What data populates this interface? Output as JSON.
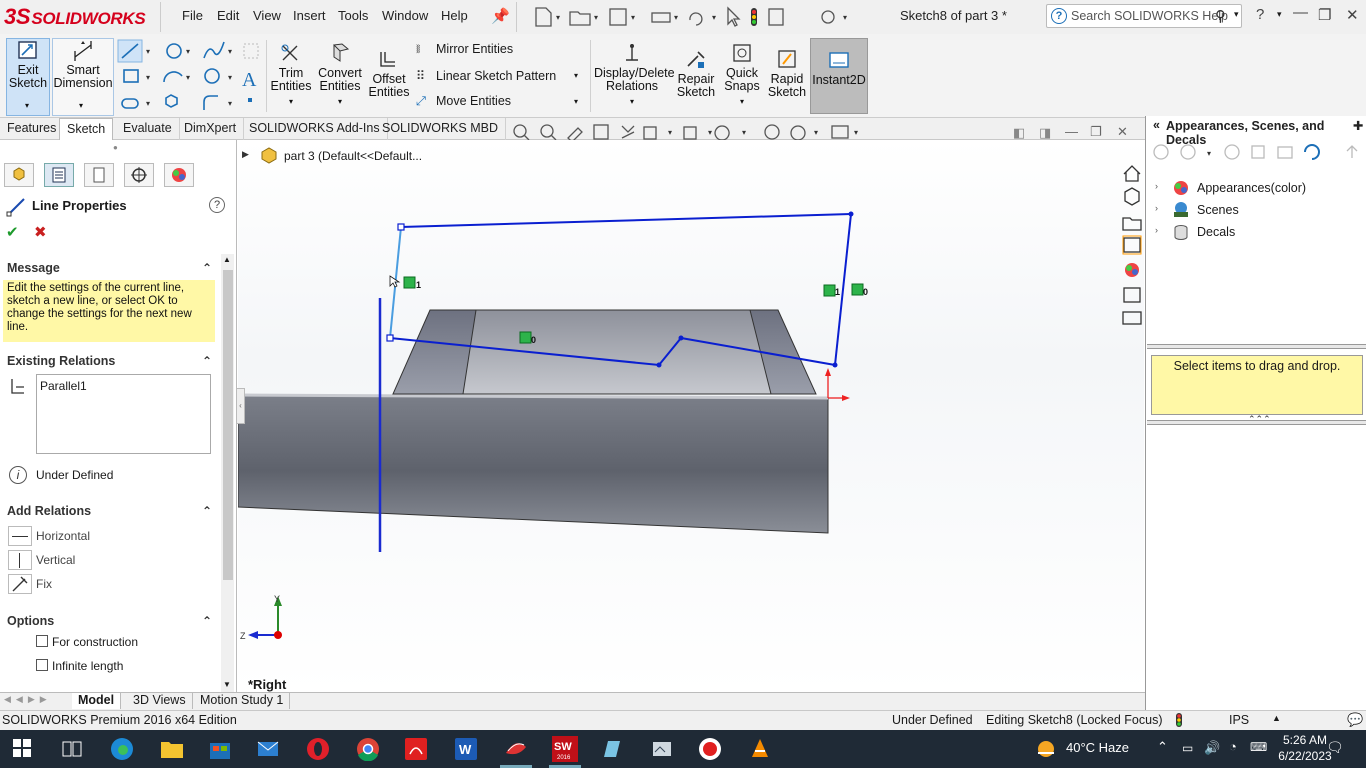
{
  "app": {
    "logo_ds": "3S",
    "logo_text": "SOLIDWORKS",
    "title": "Sketch8 of part 3 *",
    "search_placeholder": "Search SOLIDWORKS Help"
  },
  "menu": [
    "File",
    "Edit",
    "View",
    "Insert",
    "Tools",
    "Window",
    "Help"
  ],
  "ribbon": {
    "exit_sketch": "Exit\nSketch",
    "smart_dimension": "Smart\nDimension",
    "trim_entities": "Trim\nEntities",
    "convert_entities": "Convert\nEntities",
    "offset_entities": "Offset\nEntities",
    "mirror_entities": "Mirror Entities",
    "linear_sketch_pattern": "Linear Sketch Pattern",
    "move_entities": "Move Entities",
    "display_delete_relations": "Display/Delete\nRelations",
    "repair_sketch": "Repair\nSketch",
    "quick_snaps": "Quick\nSnaps",
    "rapid_sketch": "Rapid\nSketch",
    "instant2d": "Instant2D"
  },
  "tabs": [
    "Features",
    "Sketch",
    "Evaluate",
    "DimXpert",
    "SOLIDWORKS Add-Ins",
    "SOLIDWORKS MBD"
  ],
  "active_tab": "Sketch",
  "tree_path": "part 3  (Default<<Default...",
  "property_manager": {
    "title": "Line Properties",
    "message_header": "Message",
    "message_text": "Edit the settings of the current line, sketch a new line, or select OK to change the settings for the next new line.",
    "existing_relations_header": "Existing Relations",
    "relations": [
      "Parallel1"
    ],
    "status": "Under Defined",
    "add_relations_header": "Add Relations",
    "add_relations": [
      "Horizontal",
      "Vertical",
      "Fix"
    ],
    "options_header": "Options",
    "options": [
      {
        "label": "For construction",
        "checked": false
      },
      {
        "label": "Infinite length",
        "checked": false
      }
    ]
  },
  "viewport": {
    "view_name": "*Right",
    "axis_y": "Y",
    "axis_z": "Z",
    "relation_labels": [
      "1",
      "1",
      "0",
      "0"
    ]
  },
  "bottom_tabs": [
    "Model",
    "3D Views",
    "Motion Study 1"
  ],
  "active_bottom_tab": "Model",
  "statusbar": {
    "edition": "SOLIDWORKS Premium 2016 x64 Edition",
    "state": "Under Defined",
    "editing": "Editing Sketch8 (Locked Focus)",
    "units": "IPS"
  },
  "task_pane": {
    "title": "Appearances, Scenes, and Decals",
    "items": [
      "Appearances(color)",
      "Scenes",
      "Decals"
    ],
    "drop_hint": "Select items to drag and drop."
  },
  "taskbar": {
    "temperature": "40°C  Haze",
    "time": "5:26 AM",
    "date": "6/22/2023"
  },
  "colors": {
    "sketch_line": "#0a1fd0",
    "selected_line": "#4a9de0",
    "message_bg": "#fff8a6",
    "logo_red": "#d5001c",
    "taskbar_bg": "#1f2a36"
  }
}
